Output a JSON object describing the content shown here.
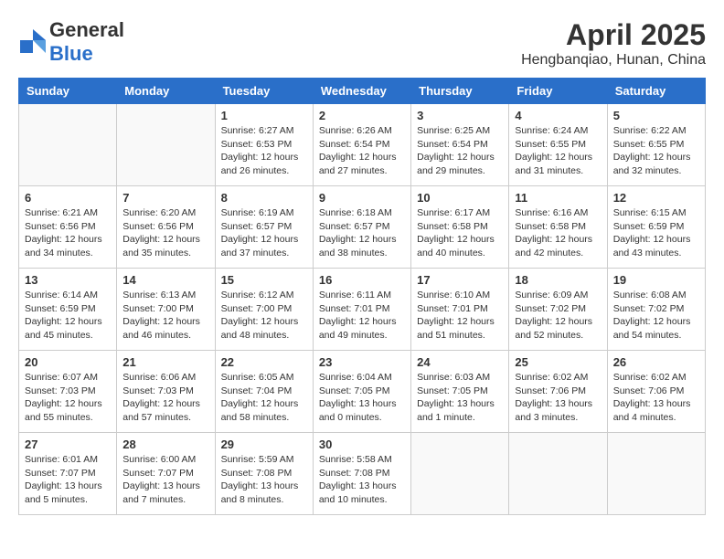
{
  "header": {
    "logo_general": "General",
    "logo_blue": "Blue",
    "month_year": "April 2025",
    "location": "Hengbanqiao, Hunan, China"
  },
  "days_of_week": [
    "Sunday",
    "Monday",
    "Tuesday",
    "Wednesday",
    "Thursday",
    "Friday",
    "Saturday"
  ],
  "weeks": [
    [
      {
        "day": "",
        "info": ""
      },
      {
        "day": "",
        "info": ""
      },
      {
        "day": "1",
        "info": "Sunrise: 6:27 AM\nSunset: 6:53 PM\nDaylight: 12 hours\nand 26 minutes."
      },
      {
        "day": "2",
        "info": "Sunrise: 6:26 AM\nSunset: 6:54 PM\nDaylight: 12 hours\nand 27 minutes."
      },
      {
        "day": "3",
        "info": "Sunrise: 6:25 AM\nSunset: 6:54 PM\nDaylight: 12 hours\nand 29 minutes."
      },
      {
        "day": "4",
        "info": "Sunrise: 6:24 AM\nSunset: 6:55 PM\nDaylight: 12 hours\nand 31 minutes."
      },
      {
        "day": "5",
        "info": "Sunrise: 6:22 AM\nSunset: 6:55 PM\nDaylight: 12 hours\nand 32 minutes."
      }
    ],
    [
      {
        "day": "6",
        "info": "Sunrise: 6:21 AM\nSunset: 6:56 PM\nDaylight: 12 hours\nand 34 minutes."
      },
      {
        "day": "7",
        "info": "Sunrise: 6:20 AM\nSunset: 6:56 PM\nDaylight: 12 hours\nand 35 minutes."
      },
      {
        "day": "8",
        "info": "Sunrise: 6:19 AM\nSunset: 6:57 PM\nDaylight: 12 hours\nand 37 minutes."
      },
      {
        "day": "9",
        "info": "Sunrise: 6:18 AM\nSunset: 6:57 PM\nDaylight: 12 hours\nand 38 minutes."
      },
      {
        "day": "10",
        "info": "Sunrise: 6:17 AM\nSunset: 6:58 PM\nDaylight: 12 hours\nand 40 minutes."
      },
      {
        "day": "11",
        "info": "Sunrise: 6:16 AM\nSunset: 6:58 PM\nDaylight: 12 hours\nand 42 minutes."
      },
      {
        "day": "12",
        "info": "Sunrise: 6:15 AM\nSunset: 6:59 PM\nDaylight: 12 hours\nand 43 minutes."
      }
    ],
    [
      {
        "day": "13",
        "info": "Sunrise: 6:14 AM\nSunset: 6:59 PM\nDaylight: 12 hours\nand 45 minutes."
      },
      {
        "day": "14",
        "info": "Sunrise: 6:13 AM\nSunset: 7:00 PM\nDaylight: 12 hours\nand 46 minutes."
      },
      {
        "day": "15",
        "info": "Sunrise: 6:12 AM\nSunset: 7:00 PM\nDaylight: 12 hours\nand 48 minutes."
      },
      {
        "day": "16",
        "info": "Sunrise: 6:11 AM\nSunset: 7:01 PM\nDaylight: 12 hours\nand 49 minutes."
      },
      {
        "day": "17",
        "info": "Sunrise: 6:10 AM\nSunset: 7:01 PM\nDaylight: 12 hours\nand 51 minutes."
      },
      {
        "day": "18",
        "info": "Sunrise: 6:09 AM\nSunset: 7:02 PM\nDaylight: 12 hours\nand 52 minutes."
      },
      {
        "day": "19",
        "info": "Sunrise: 6:08 AM\nSunset: 7:02 PM\nDaylight: 12 hours\nand 54 minutes."
      }
    ],
    [
      {
        "day": "20",
        "info": "Sunrise: 6:07 AM\nSunset: 7:03 PM\nDaylight: 12 hours\nand 55 minutes."
      },
      {
        "day": "21",
        "info": "Sunrise: 6:06 AM\nSunset: 7:03 PM\nDaylight: 12 hours\nand 57 minutes."
      },
      {
        "day": "22",
        "info": "Sunrise: 6:05 AM\nSunset: 7:04 PM\nDaylight: 12 hours\nand 58 minutes."
      },
      {
        "day": "23",
        "info": "Sunrise: 6:04 AM\nSunset: 7:05 PM\nDaylight: 13 hours\nand 0 minutes."
      },
      {
        "day": "24",
        "info": "Sunrise: 6:03 AM\nSunset: 7:05 PM\nDaylight: 13 hours\nand 1 minute."
      },
      {
        "day": "25",
        "info": "Sunrise: 6:02 AM\nSunset: 7:06 PM\nDaylight: 13 hours\nand 3 minutes."
      },
      {
        "day": "26",
        "info": "Sunrise: 6:02 AM\nSunset: 7:06 PM\nDaylight: 13 hours\nand 4 minutes."
      }
    ],
    [
      {
        "day": "27",
        "info": "Sunrise: 6:01 AM\nSunset: 7:07 PM\nDaylight: 13 hours\nand 5 minutes."
      },
      {
        "day": "28",
        "info": "Sunrise: 6:00 AM\nSunset: 7:07 PM\nDaylight: 13 hours\nand 7 minutes."
      },
      {
        "day": "29",
        "info": "Sunrise: 5:59 AM\nSunset: 7:08 PM\nDaylight: 13 hours\nand 8 minutes."
      },
      {
        "day": "30",
        "info": "Sunrise: 5:58 AM\nSunset: 7:08 PM\nDaylight: 13 hours\nand 10 minutes."
      },
      {
        "day": "",
        "info": ""
      },
      {
        "day": "",
        "info": ""
      },
      {
        "day": "",
        "info": ""
      }
    ]
  ]
}
